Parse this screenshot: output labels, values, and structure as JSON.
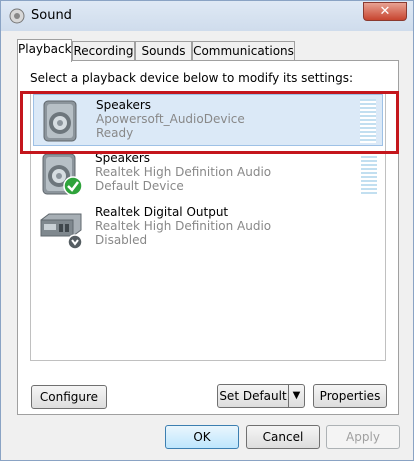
{
  "window": {
    "title": "Sound",
    "close_label": "✕"
  },
  "tabs": [
    {
      "label": "Playback",
      "active": true
    },
    {
      "label": "Recording",
      "active": false
    },
    {
      "label": "Sounds",
      "active": false
    },
    {
      "label": "Communications",
      "active": false
    }
  ],
  "playback": {
    "instruction": "Select a playback device below to modify its settings:",
    "devices": [
      {
        "name": "Speakers",
        "driver": "Apowersoft_AudioDevice",
        "status": "Ready",
        "icon": "speaker-icon",
        "selected": true
      },
      {
        "name": "Speakers",
        "driver": "Realtek High Definition Audio",
        "status": "Default Device",
        "icon": "speaker-default-icon",
        "selected": false
      },
      {
        "name": "Realtek Digital Output",
        "driver": "Realtek High Definition Audio",
        "status": "Disabled",
        "icon": "digital-output-icon",
        "selected": false
      }
    ]
  },
  "buttons": {
    "configure": "Configure",
    "set_default": "Set Default",
    "properties": "Properties",
    "ok": "OK",
    "cancel": "Cancel",
    "apply": "Apply"
  },
  "colors": {
    "highlight": "#c4161c",
    "selection": "#dbe9f7",
    "default_check": "#2fa33b"
  }
}
